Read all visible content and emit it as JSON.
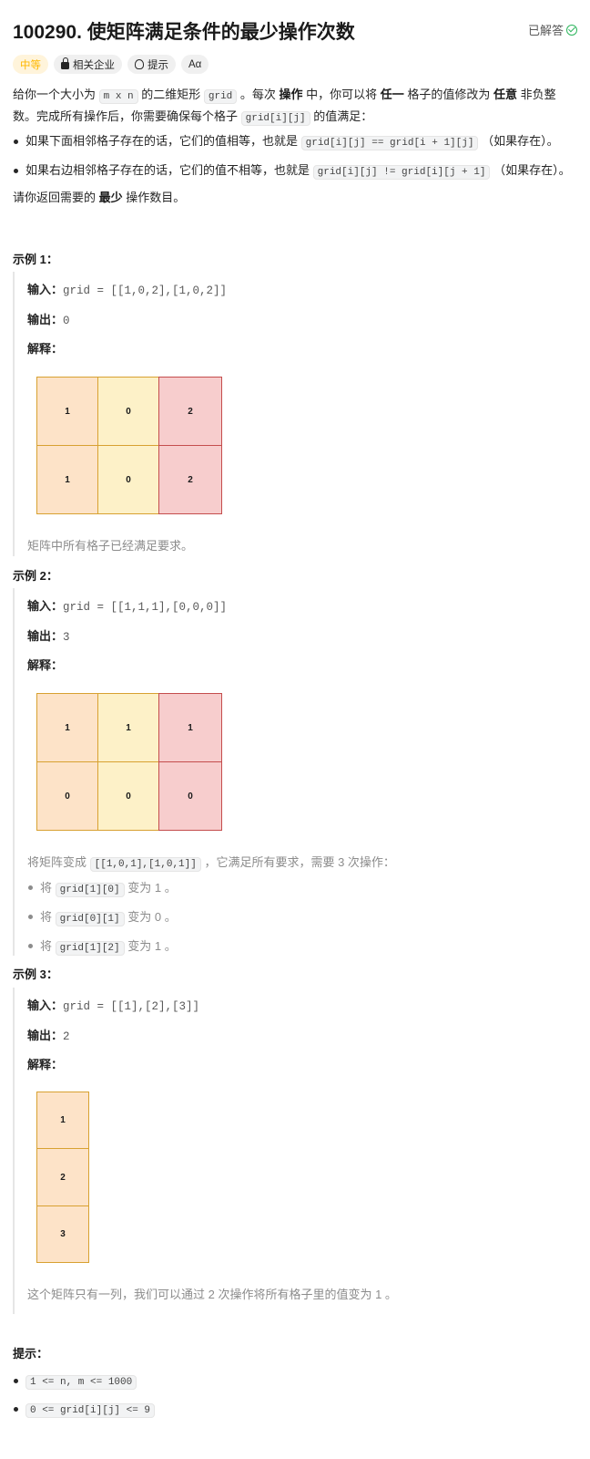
{
  "header": {
    "title": "100290. 使矩阵满足条件的最少操作次数",
    "status": "已解答"
  },
  "tags": {
    "difficulty": "中等",
    "companies": "相关企业",
    "hint": "提示",
    "font": "Aα"
  },
  "description": {
    "p1": [
      "给你一个大小为 ",
      "m x n",
      " 的二维矩形 ",
      "grid",
      " 。每次 ",
      "操作",
      " 中，你可以将 ",
      "任一",
      " 格子的值修改为 ",
      "任意",
      " 非负整数。完成所有操作后，你需要确保每个格子 ",
      "grid[i][j]",
      " 的值满足："
    ],
    "b1": [
      "如果下面相邻格子存在的话，它们的值相等，也就是 ",
      "grid[i][j] == grid[i + 1][j]",
      " （如果存在）。"
    ],
    "b2": [
      "如果右边相邻格子存在的话，它们的值不相等，也就是 ",
      "grid[i][j] != grid[i][j + 1]",
      " （如果存在）。"
    ],
    "p2": [
      "请你返回需要的 ",
      "最少",
      " 操作数目。"
    ]
  },
  "examples": [
    {
      "title": "示例 1：",
      "input_label": "输入：",
      "input": "grid = [[1,0,2],[1,0,2]]",
      "output_label": "输出：",
      "output": "0",
      "explain_label": "解释：",
      "grid": [
        [
          "1",
          "0",
          "2"
        ],
        [
          "1",
          "0",
          "2"
        ]
      ],
      "note": "矩阵中所有格子已经满足要求。"
    },
    {
      "title": "示例 2：",
      "input_label": "输入：",
      "input": "grid = [[1,1,1],[0,0,0]]",
      "output_label": "输出：",
      "output": "3",
      "explain_label": "解释：",
      "grid": [
        [
          "1",
          "1",
          "1"
        ],
        [
          "0",
          "0",
          "0"
        ]
      ],
      "note": [
        "将矩阵变成 ",
        "[[1,0,1],[1,0,1]]",
        " ，它满足所有要求，需要 3 次操作："
      ],
      "steps": [
        [
          "将 ",
          "grid[1][0]",
          " 变为 1 。"
        ],
        [
          "将 ",
          "grid[0][1]",
          " 变为 0 。"
        ],
        [
          "将 ",
          "grid[1][2]",
          " 变为 1 。"
        ]
      ]
    },
    {
      "title": "示例 3：",
      "input_label": "输入：",
      "input": "grid = [[1],[2],[3]]",
      "output_label": "输出：",
      "output": "2",
      "explain_label": "解释：",
      "grid": [
        [
          "1"
        ],
        [
          "2"
        ],
        [
          "3"
        ]
      ],
      "note": "这个矩阵只有一列，我们可以通过 2 次操作将所有格子里的值变为 1 。"
    }
  ],
  "constraints": {
    "title": "提示：",
    "items": [
      "1 <= n, m <= 1000",
      "0 <= grid[i][j] <= 9"
    ]
  },
  "colors": {
    "cell_orange": "#fde3c8",
    "cell_yellow": "#fdf1c8",
    "cell_red": "#f7cdcd",
    "difficulty": "#ffb800",
    "solved_check": "#2db55d"
  }
}
